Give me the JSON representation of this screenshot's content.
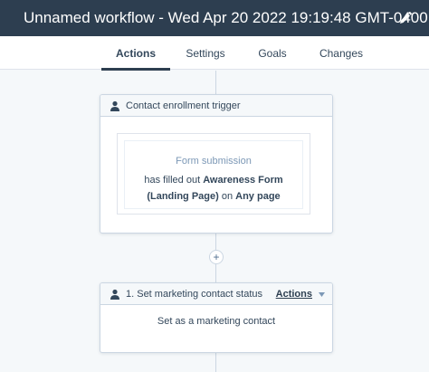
{
  "header": {
    "title": "Unnamed workflow - Wed Apr 20 2022 19:19:48 GMT-0400"
  },
  "tabs": [
    {
      "label": "Actions",
      "active": true
    },
    {
      "label": "Settings",
      "active": false
    },
    {
      "label": "Goals",
      "active": false
    },
    {
      "label": "Changes",
      "active": false
    }
  ],
  "trigger": {
    "title": "Contact enrollment trigger",
    "type_label": "Form submission",
    "text_prefix": "has filled out ",
    "form_name": "Awareness Form (Landing Page)",
    "text_mid": " on ",
    "page_name": "Any page"
  },
  "add_step": {
    "symbol": "+"
  },
  "action_1": {
    "title": "1. Set marketing contact status",
    "menu_label": "Actions",
    "body": "Set as a marketing contact"
  },
  "colors": {
    "header_bg": "#2d3e50",
    "canvas_bg": "#f5f8fa",
    "border": "#cbd6e2",
    "muted_text": "#7c98b6"
  },
  "icons": {
    "edit": "pencil-icon",
    "person": "person-icon",
    "caret": "caret-down-icon"
  }
}
